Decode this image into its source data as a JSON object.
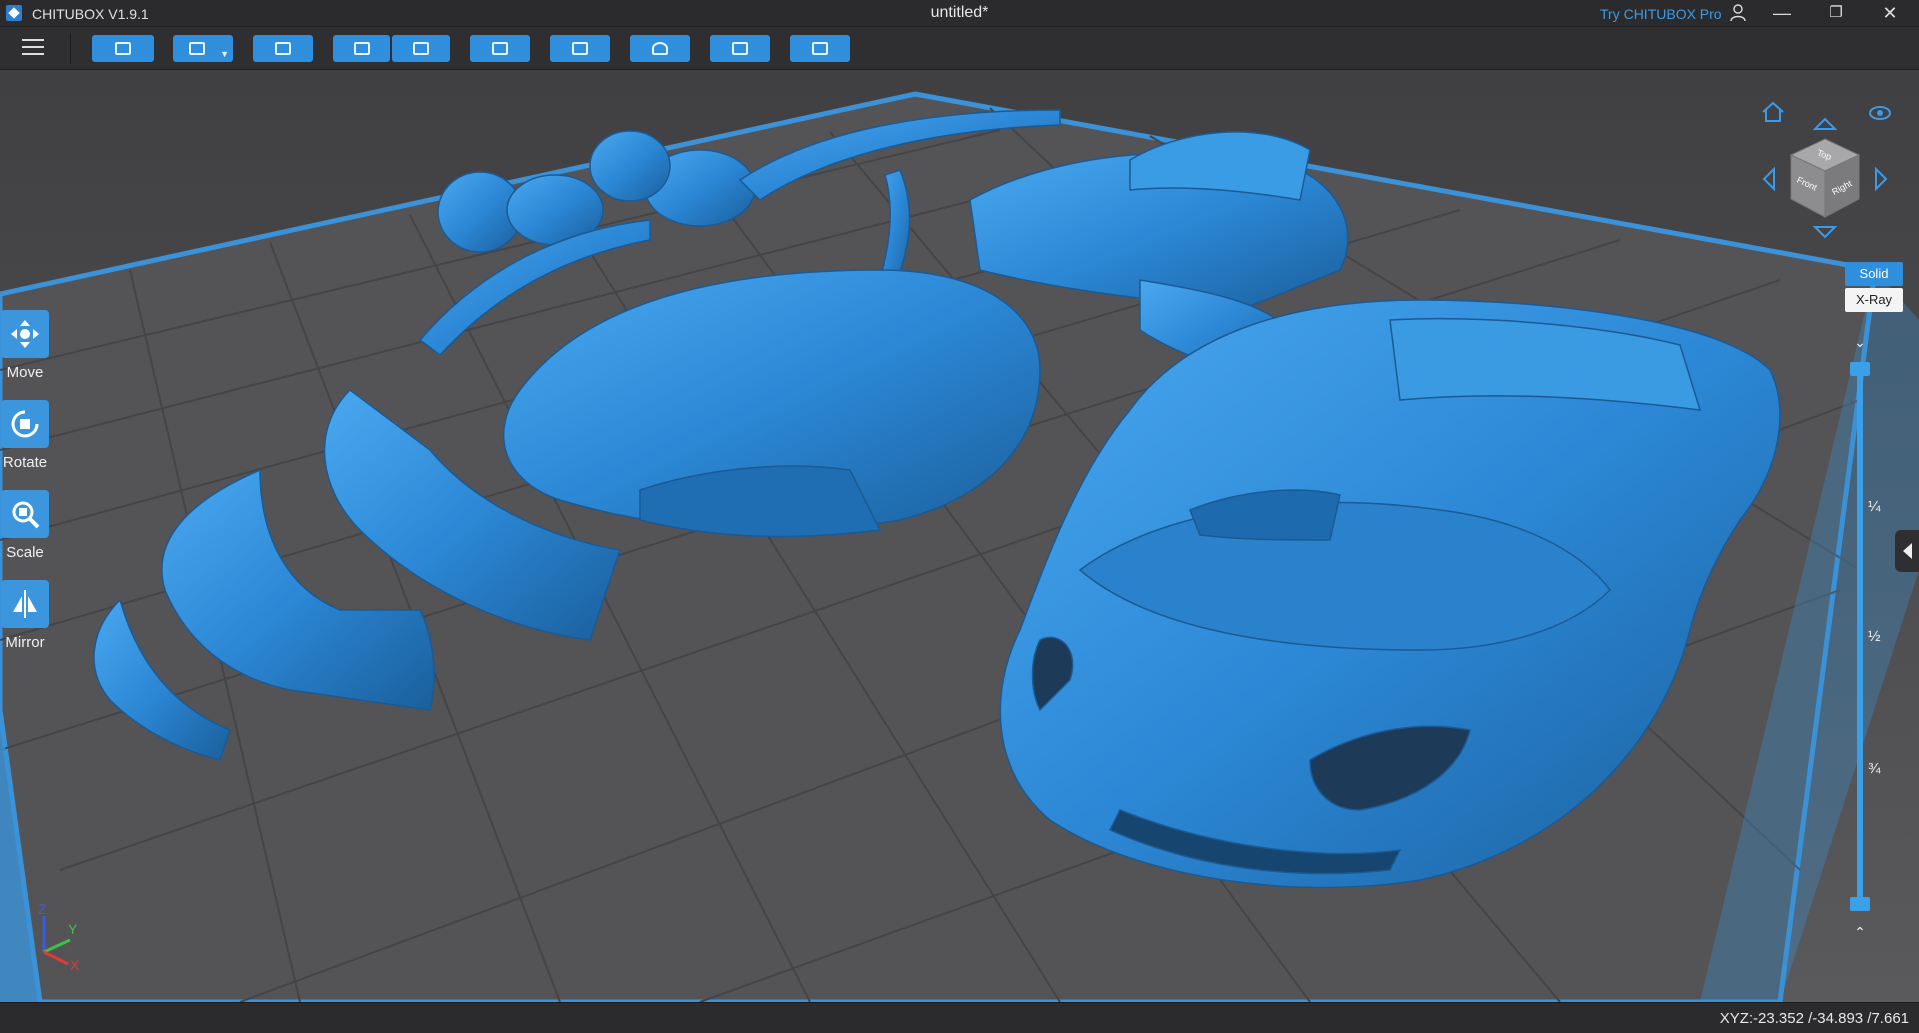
{
  "titlebar": {
    "app_name": "CHITUBOX V1.9.1",
    "document_title": "untitled*",
    "try_pro": "Try CHITUBOX Pro",
    "minimize": "—",
    "restore": "❐",
    "close": "✕"
  },
  "toolbar": {
    "buttons": [
      {
        "name": "open-file",
        "icon": "folder-icon"
      },
      {
        "name": "save",
        "icon": "save-icon",
        "has_dropdown": true
      },
      {
        "name": "screenshot",
        "icon": "screenshot-icon"
      },
      {
        "name": "undo",
        "icon": "undo-icon"
      },
      {
        "name": "redo",
        "icon": "redo-icon"
      },
      {
        "name": "settings",
        "icon": "settings-icon"
      },
      {
        "name": "auto-layout",
        "icon": "layout-icon"
      },
      {
        "name": "hollow",
        "icon": "hollow-icon"
      },
      {
        "name": "print-preview",
        "icon": "preview-icon"
      },
      {
        "name": "slice",
        "icon": "slice-icon"
      }
    ]
  },
  "tools": [
    {
      "label": "Move",
      "icon": "move-icon"
    },
    {
      "label": "Rotate",
      "icon": "rotate-icon"
    },
    {
      "label": "Scale",
      "icon": "scale-icon"
    },
    {
      "label": "Mirror",
      "icon": "mirror-icon"
    }
  ],
  "view_cube": {
    "faces": [
      "Top",
      "Front",
      "Right"
    ]
  },
  "render_modes": {
    "solid": "Solid",
    "xray": "X-Ray",
    "active": "Solid"
  },
  "layer_slider": {
    "ticks": [
      "¼",
      "½",
      "¾"
    ]
  },
  "axis": {
    "x": "X",
    "y": "Y",
    "z": "Z"
  },
  "status": {
    "coords": "XYZ:-23.352 /-34.893 /7.661"
  },
  "colors": {
    "accent": "#2f8fdd",
    "model": "#2f8fdd",
    "plate": "#555557",
    "grid": "#454547"
  }
}
